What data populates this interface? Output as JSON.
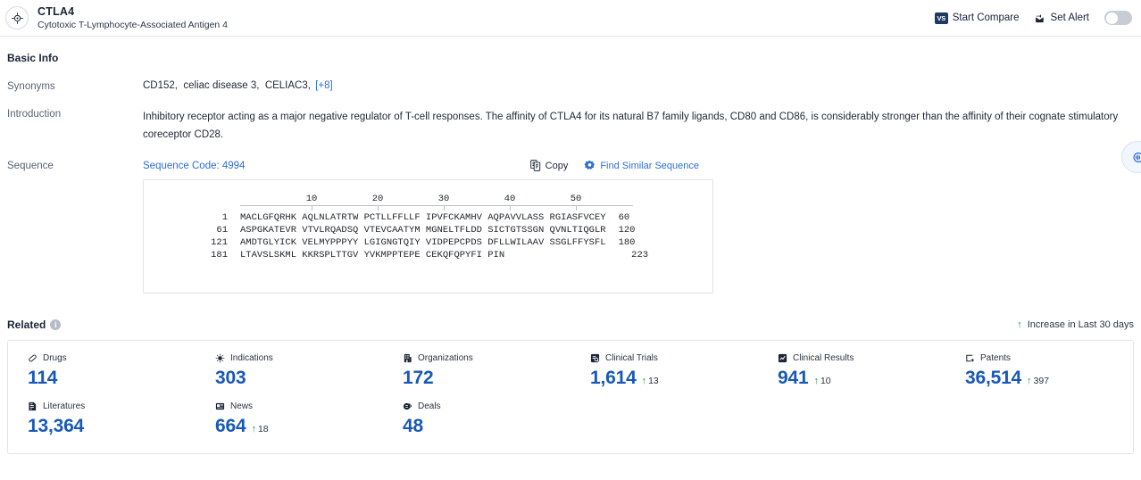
{
  "header": {
    "logo_icon": "target-crosshair-icon",
    "title": "CTLA4",
    "subtitle": "Cytotoxic T-Lymphocyte-Associated Antigen 4",
    "start_compare_label": "Start Compare",
    "start_compare_badge": "VS",
    "set_alert_label": "Set Alert",
    "alert_toggle_state": "off"
  },
  "basic_info": {
    "section_title": "Basic Info",
    "synonyms_label": "Synonyms",
    "synonyms": [
      "CD152,",
      "celiac disease 3,",
      "CELIAC3,"
    ],
    "synonyms_more": "[+8]",
    "introduction_label": "Introduction",
    "introduction": "Inhibitory receptor acting as a major negative regulator of T-cell responses. The affinity of CTLA4 for its natural B7 family ligands, CD80 and CD86, is considerably stronger than the affinity of their cognate stimulatory coreceptor CD28.",
    "sequence_label": "Sequence"
  },
  "sequence": {
    "code_label": "Sequence Code: 4994",
    "copy_label": "Copy",
    "copy_icon": "copy-icon",
    "find_similar_label": "Find Similar Sequence",
    "find_similar_icon": "find-similar-icon",
    "ruler_ticks": [
      "10",
      "20",
      "30",
      "40",
      "50"
    ],
    "lines": [
      {
        "start": "1",
        "chunks": "MACLGFQRHK AQLNLATRTW PCTLLFFLLF IPVFCKAMHV AQPAVVLASS RGIASFVCEY",
        "end": "60"
      },
      {
        "start": "61",
        "chunks": "ASPGKATEVR VTVLRQADSQ VTEVCAATYM MGNELTFLDD SICTGTSSGN QVNLTIQGLR",
        "end": "120"
      },
      {
        "start": "121",
        "chunks": "AMDTGLYICK VELMYPPPYY LGIGNGTQIY VIDPEPCPDS DFLLWILAAV SSGLFFYSFL",
        "end": "180"
      },
      {
        "start": "181",
        "chunks": "LTAVSLSKML KKRSPLTTGV YVKMPPTEPE CEKQFQPYFI PIN",
        "end": "223"
      }
    ]
  },
  "related": {
    "title": "Related",
    "info_icon": "info-icon",
    "legend_label": "Increase in Last 30 days",
    "legend_icon": "up-arrow-icon",
    "stats": [
      {
        "icon": "pill-icon",
        "label": "Drugs",
        "value": "114",
        "delta": ""
      },
      {
        "icon": "virus-icon",
        "label": "Indications",
        "value": "303",
        "delta": ""
      },
      {
        "icon": "building-icon",
        "label": "Organizations",
        "value": "172",
        "delta": ""
      },
      {
        "icon": "clinical-trial-icon",
        "label": "Clinical Trials",
        "value": "1,614",
        "delta": "13"
      },
      {
        "icon": "clinical-result-icon",
        "label": "Clinical Results",
        "value": "941",
        "delta": "10"
      },
      {
        "icon": "patent-icon",
        "label": "Patents",
        "value": "36,514",
        "delta": "397"
      },
      {
        "icon": "literature-icon",
        "label": "Literatures",
        "value": "13,364",
        "delta": ""
      },
      {
        "icon": "news-icon",
        "label": "News",
        "value": "664",
        "delta": "18"
      },
      {
        "icon": "deal-icon",
        "label": "Deals",
        "value": "48",
        "delta": ""
      }
    ]
  },
  "float_tab": {
    "icon": "chat-bubble-icon"
  },
  "colors": {
    "accent_blue": "#1859b8",
    "link_blue": "#2f6fd0",
    "increase_green": "#1f9254",
    "text_dark": "#1c2535",
    "text_muted": "#5a6472"
  }
}
